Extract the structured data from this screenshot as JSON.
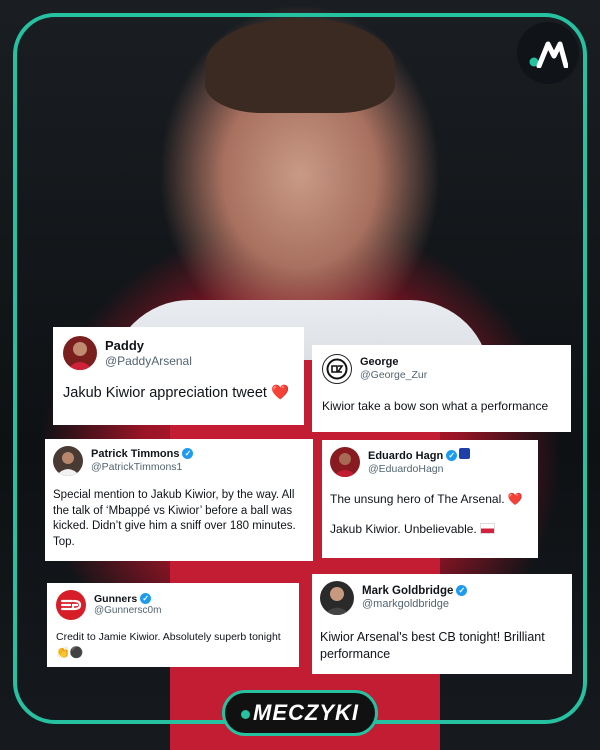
{
  "brand": {
    "name": "MECZYKI",
    "logo_icon": "meczyki-m-logo"
  },
  "colors": {
    "accent": "#25c1a1",
    "verified": "#1d9bf0",
    "heart": "#e0245e"
  },
  "tweets": [
    {
      "name": "Paddy",
      "handle": "@PaddyArsenal",
      "text": "Jakub Kiwior appreciation tweet",
      "emoji": "❤️",
      "avatar": "player-avatar"
    },
    {
      "name": "George",
      "handle": "@George_Zur",
      "text": "Kiwior take a bow son what a performance",
      "avatar": "gz-logo-avatar"
    },
    {
      "name": "Patrick Timmons",
      "handle": "@PatrickTimmons1",
      "verified": true,
      "text": "Special mention to Jakub Kiwior, by the way. All the talk of ‘Mbappé vs Kiwior’ before a ball was kicked. Didn’t give him a sniff over 180 minutes. Top.",
      "avatar": "player-avatar"
    },
    {
      "name": "Eduardo Hagn",
      "handle": "@EduardoHagn",
      "verified": true,
      "text": "The unsung hero of The Arsenal.",
      "emoji": "❤️",
      "text2": "Jakub Kiwior. Unbelievable.",
      "avatar": "player-avatar"
    },
    {
      "name": "Gunners",
      "handle": "@Gunnersc0m",
      "verified": true,
      "text": "Credit to Jamie Kiwior. Absolutely superb tonight",
      "emoji": "👏⚫",
      "avatar": "gunners-logo-avatar"
    },
    {
      "name": "Mark Goldbridge",
      "handle": "@markgoldbridge",
      "verified": true,
      "text": "Kiwior Arsenal's best CB tonight! Brilliant performance",
      "avatar": "person-avatar"
    }
  ]
}
